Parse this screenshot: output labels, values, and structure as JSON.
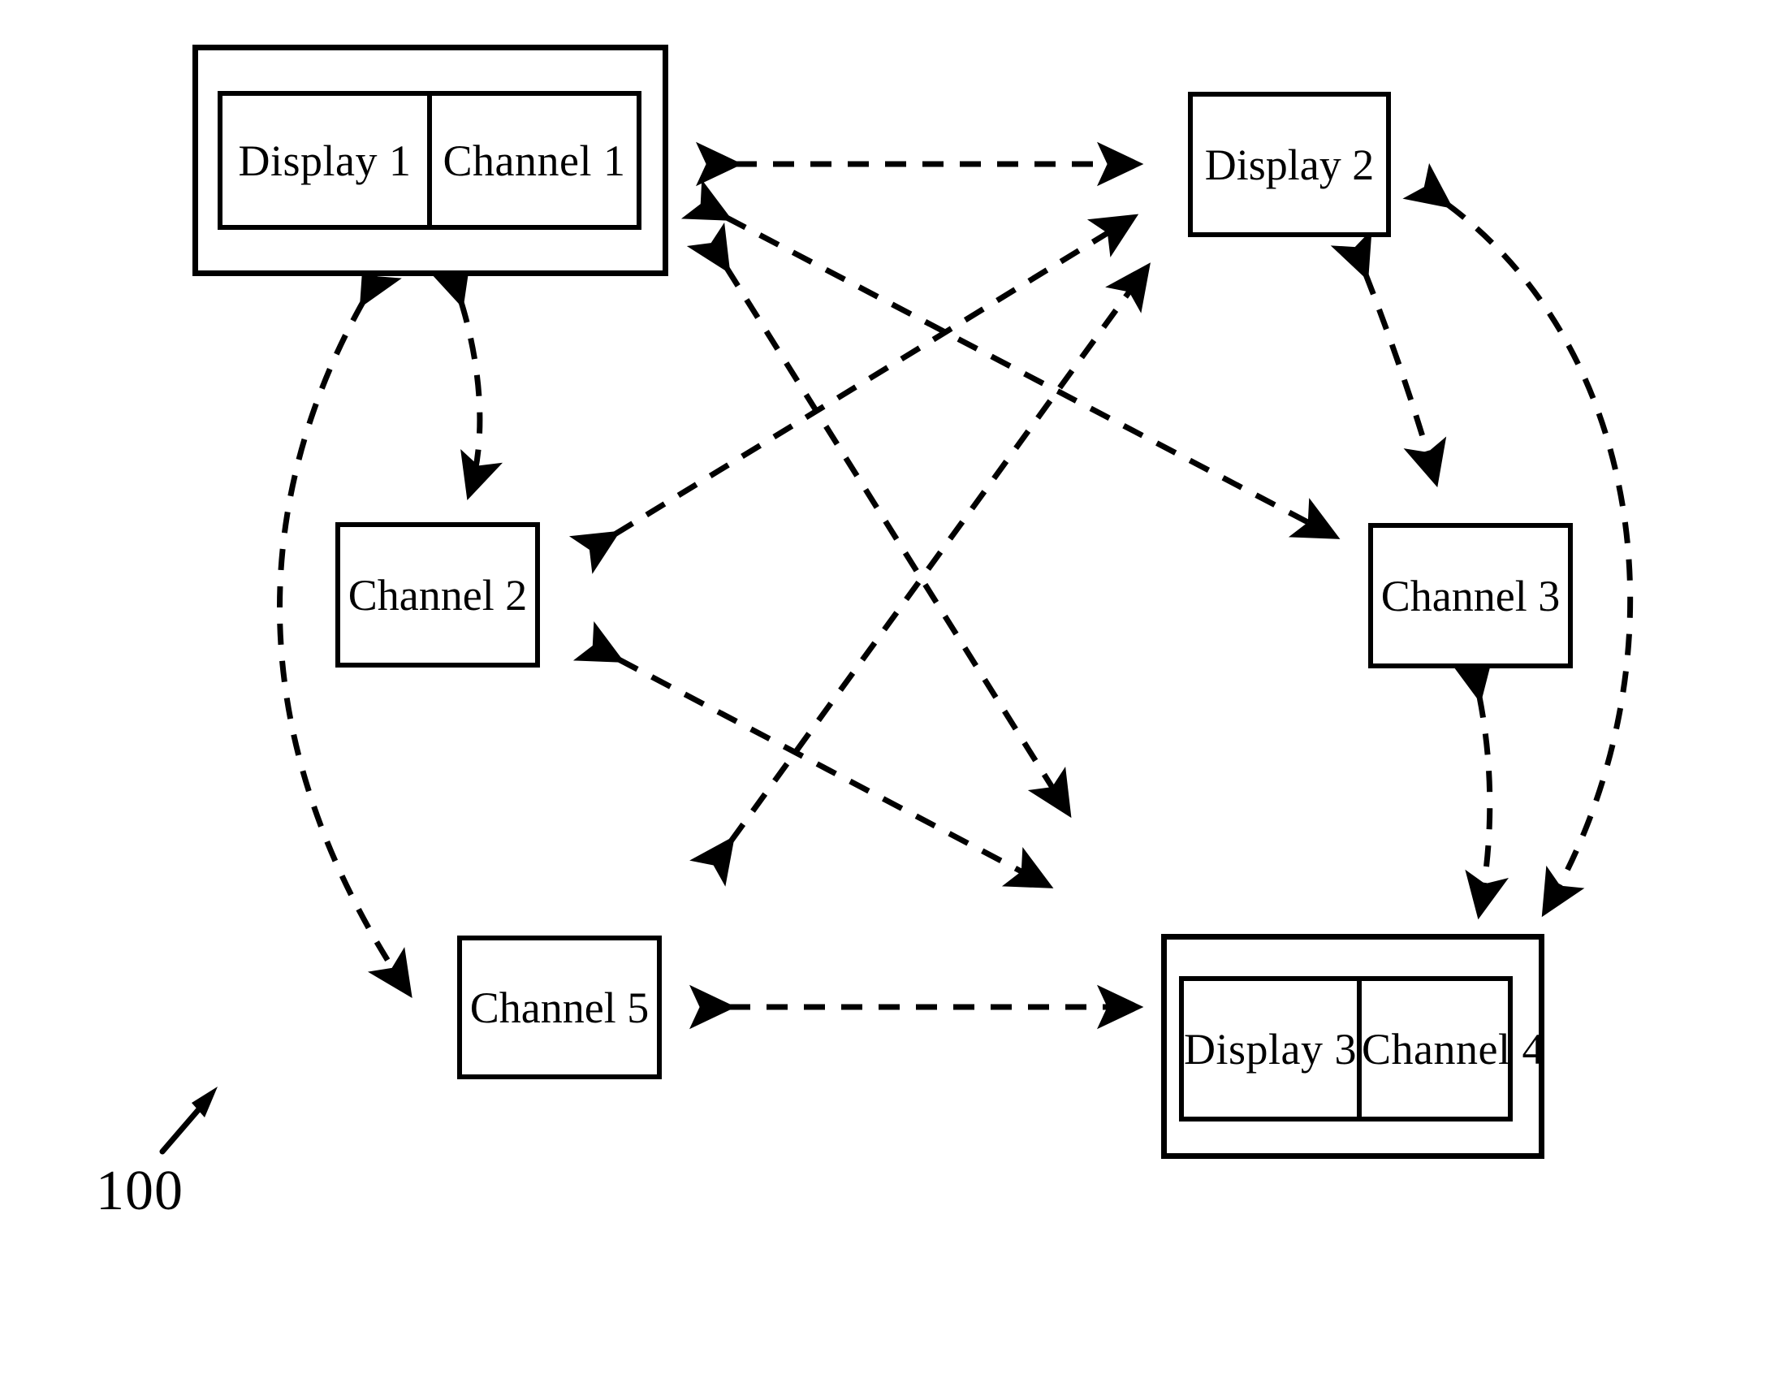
{
  "figure": {
    "number_label": "100",
    "background_color": "#ffffff",
    "line_color": "#000000"
  },
  "nodes": {
    "display1_group": {
      "display_label": "Display 1",
      "channel_label": "Channel 1"
    },
    "display2": {
      "label": "Display 2"
    },
    "channel2": {
      "label": "Channel 2"
    },
    "channel3": {
      "label": "Channel 3"
    },
    "channel5": {
      "label": "Channel 5"
    },
    "display3_group": {
      "display_label": "Display 3",
      "channel_label": "Channel 4"
    }
  },
  "connections": [
    {
      "id": "conn-display1-display2",
      "from": "Display 1 / Channel 1",
      "to": "Display 2",
      "style": "dashed",
      "arrows": "both",
      "shape": "straight"
    },
    {
      "id": "conn-display1-channel2",
      "from": "Display 1 / Channel 1",
      "to": "Channel 2",
      "style": "dashed",
      "arrows": "both",
      "shape": "curved"
    },
    {
      "id": "conn-display1-channel5",
      "from": "Display 1 / Channel 1",
      "to": "Channel 5",
      "style": "dashed",
      "arrows": "both",
      "shape": "curved"
    },
    {
      "id": "conn-display2-channel3",
      "from": "Display 2",
      "to": "Channel 3",
      "style": "dashed",
      "arrows": "both",
      "shape": "curved"
    },
    {
      "id": "conn-display2-display3",
      "from": "Display 2",
      "to": "Display 3 / Channel 4",
      "style": "dashed",
      "arrows": "both",
      "shape": "curved"
    },
    {
      "id": "conn-channel3-display3",
      "from": "Channel 3",
      "to": "Display 3 / Channel 4",
      "style": "dashed",
      "arrows": "both",
      "shape": "curved"
    },
    {
      "id": "conn-channel5-display3",
      "from": "Channel 5",
      "to": "Display 3 / Channel 4",
      "style": "dashed",
      "arrows": "both",
      "shape": "straight"
    },
    {
      "id": "conn-channel2-display2",
      "from": "Channel 2",
      "to": "Display 2",
      "style": "dashed",
      "arrows": "both",
      "shape": "straight"
    },
    {
      "id": "conn-channel2-display3",
      "from": "Channel 2",
      "to": "Display 3 / Channel 4",
      "style": "dashed",
      "arrows": "both",
      "shape": "straight"
    },
    {
      "id": "conn-channel5-display2",
      "from": "Channel 5",
      "to": "Display 2",
      "style": "dashed",
      "arrows": "both",
      "shape": "straight"
    },
    {
      "id": "conn-channel5-channel3",
      "from": "Channel 5",
      "to": "Channel 3",
      "style": "dashed",
      "arrows": "both",
      "shape": "straight"
    }
  ]
}
